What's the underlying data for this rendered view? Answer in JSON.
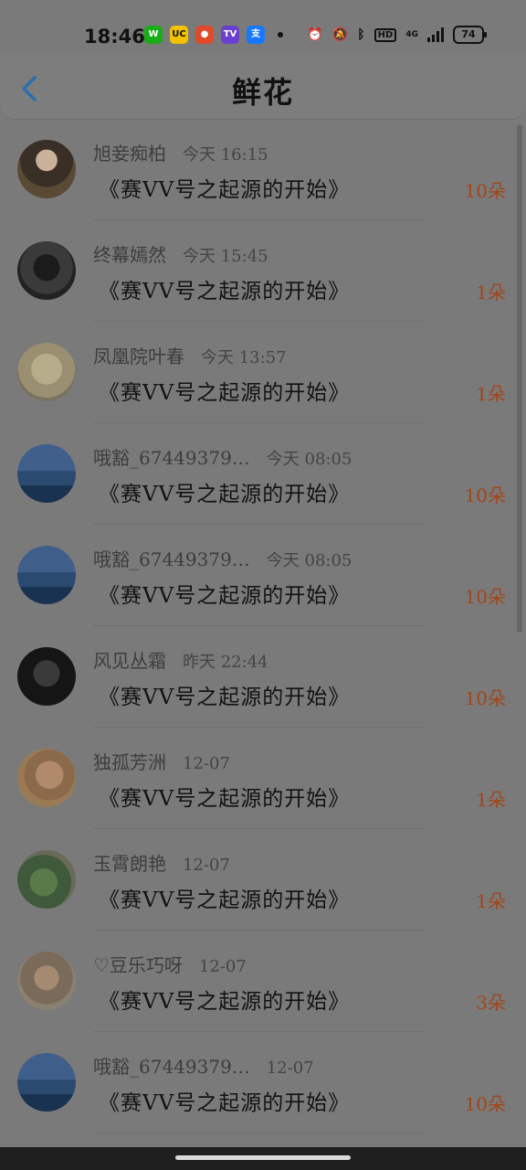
{
  "status_bar": {
    "time": "18:46",
    "app_icons": [
      "wechat-icon",
      "uc-icon",
      "browser-icon",
      "tv-icon",
      "alipay-icon"
    ],
    "app_glyphs": [
      "W",
      "UC",
      "●",
      "TV",
      "支"
    ],
    "signal": "4G",
    "hd": "HD",
    "battery": "74"
  },
  "header": {
    "title": "鲜花",
    "back_icon": "chevron-left-icon"
  },
  "records": [
    {
      "name": "旭妾痴柏",
      "time": "今天 16:15",
      "message": "《赛VV号之起源的开始》",
      "count": "10朵"
    },
    {
      "name": "终幕嫣然",
      "time": "今天 15:45",
      "message": "《赛VV号之起源的开始》",
      "count": "1朵"
    },
    {
      "name": "凤凰院叶春",
      "time": "今天 13:57",
      "message": "《赛VV号之起源的开始》",
      "count": "1朵"
    },
    {
      "name": "哦豁_67449379…",
      "time": "今天 08:05",
      "message": "《赛VV号之起源的开始》",
      "count": "10朵"
    },
    {
      "name": "哦豁_67449379…",
      "time": "今天 08:05",
      "message": "《赛VV号之起源的开始》",
      "count": "10朵"
    },
    {
      "name": "风见丛霜",
      "time": "昨天 22:44",
      "message": "《赛VV号之起源的开始》",
      "count": "10朵"
    },
    {
      "name": "独孤芳洲",
      "time": "12-07",
      "message": "《赛VV号之起源的开始》",
      "count": "1朵"
    },
    {
      "name": "玉霄朗艳",
      "time": "12-07",
      "message": "《赛VV号之起源的开始》",
      "count": "1朵"
    },
    {
      "name": "♡豆乐巧呀",
      "time": "12-07",
      "message": "《赛VV号之起源的开始》",
      "count": "3朵"
    },
    {
      "name": "哦豁_67449379…",
      "time": "12-07",
      "message": "《赛VV号之起源的开始》",
      "count": "10朵"
    }
  ],
  "colors": {
    "count": "#a24618",
    "back": "#2a6fb0"
  }
}
